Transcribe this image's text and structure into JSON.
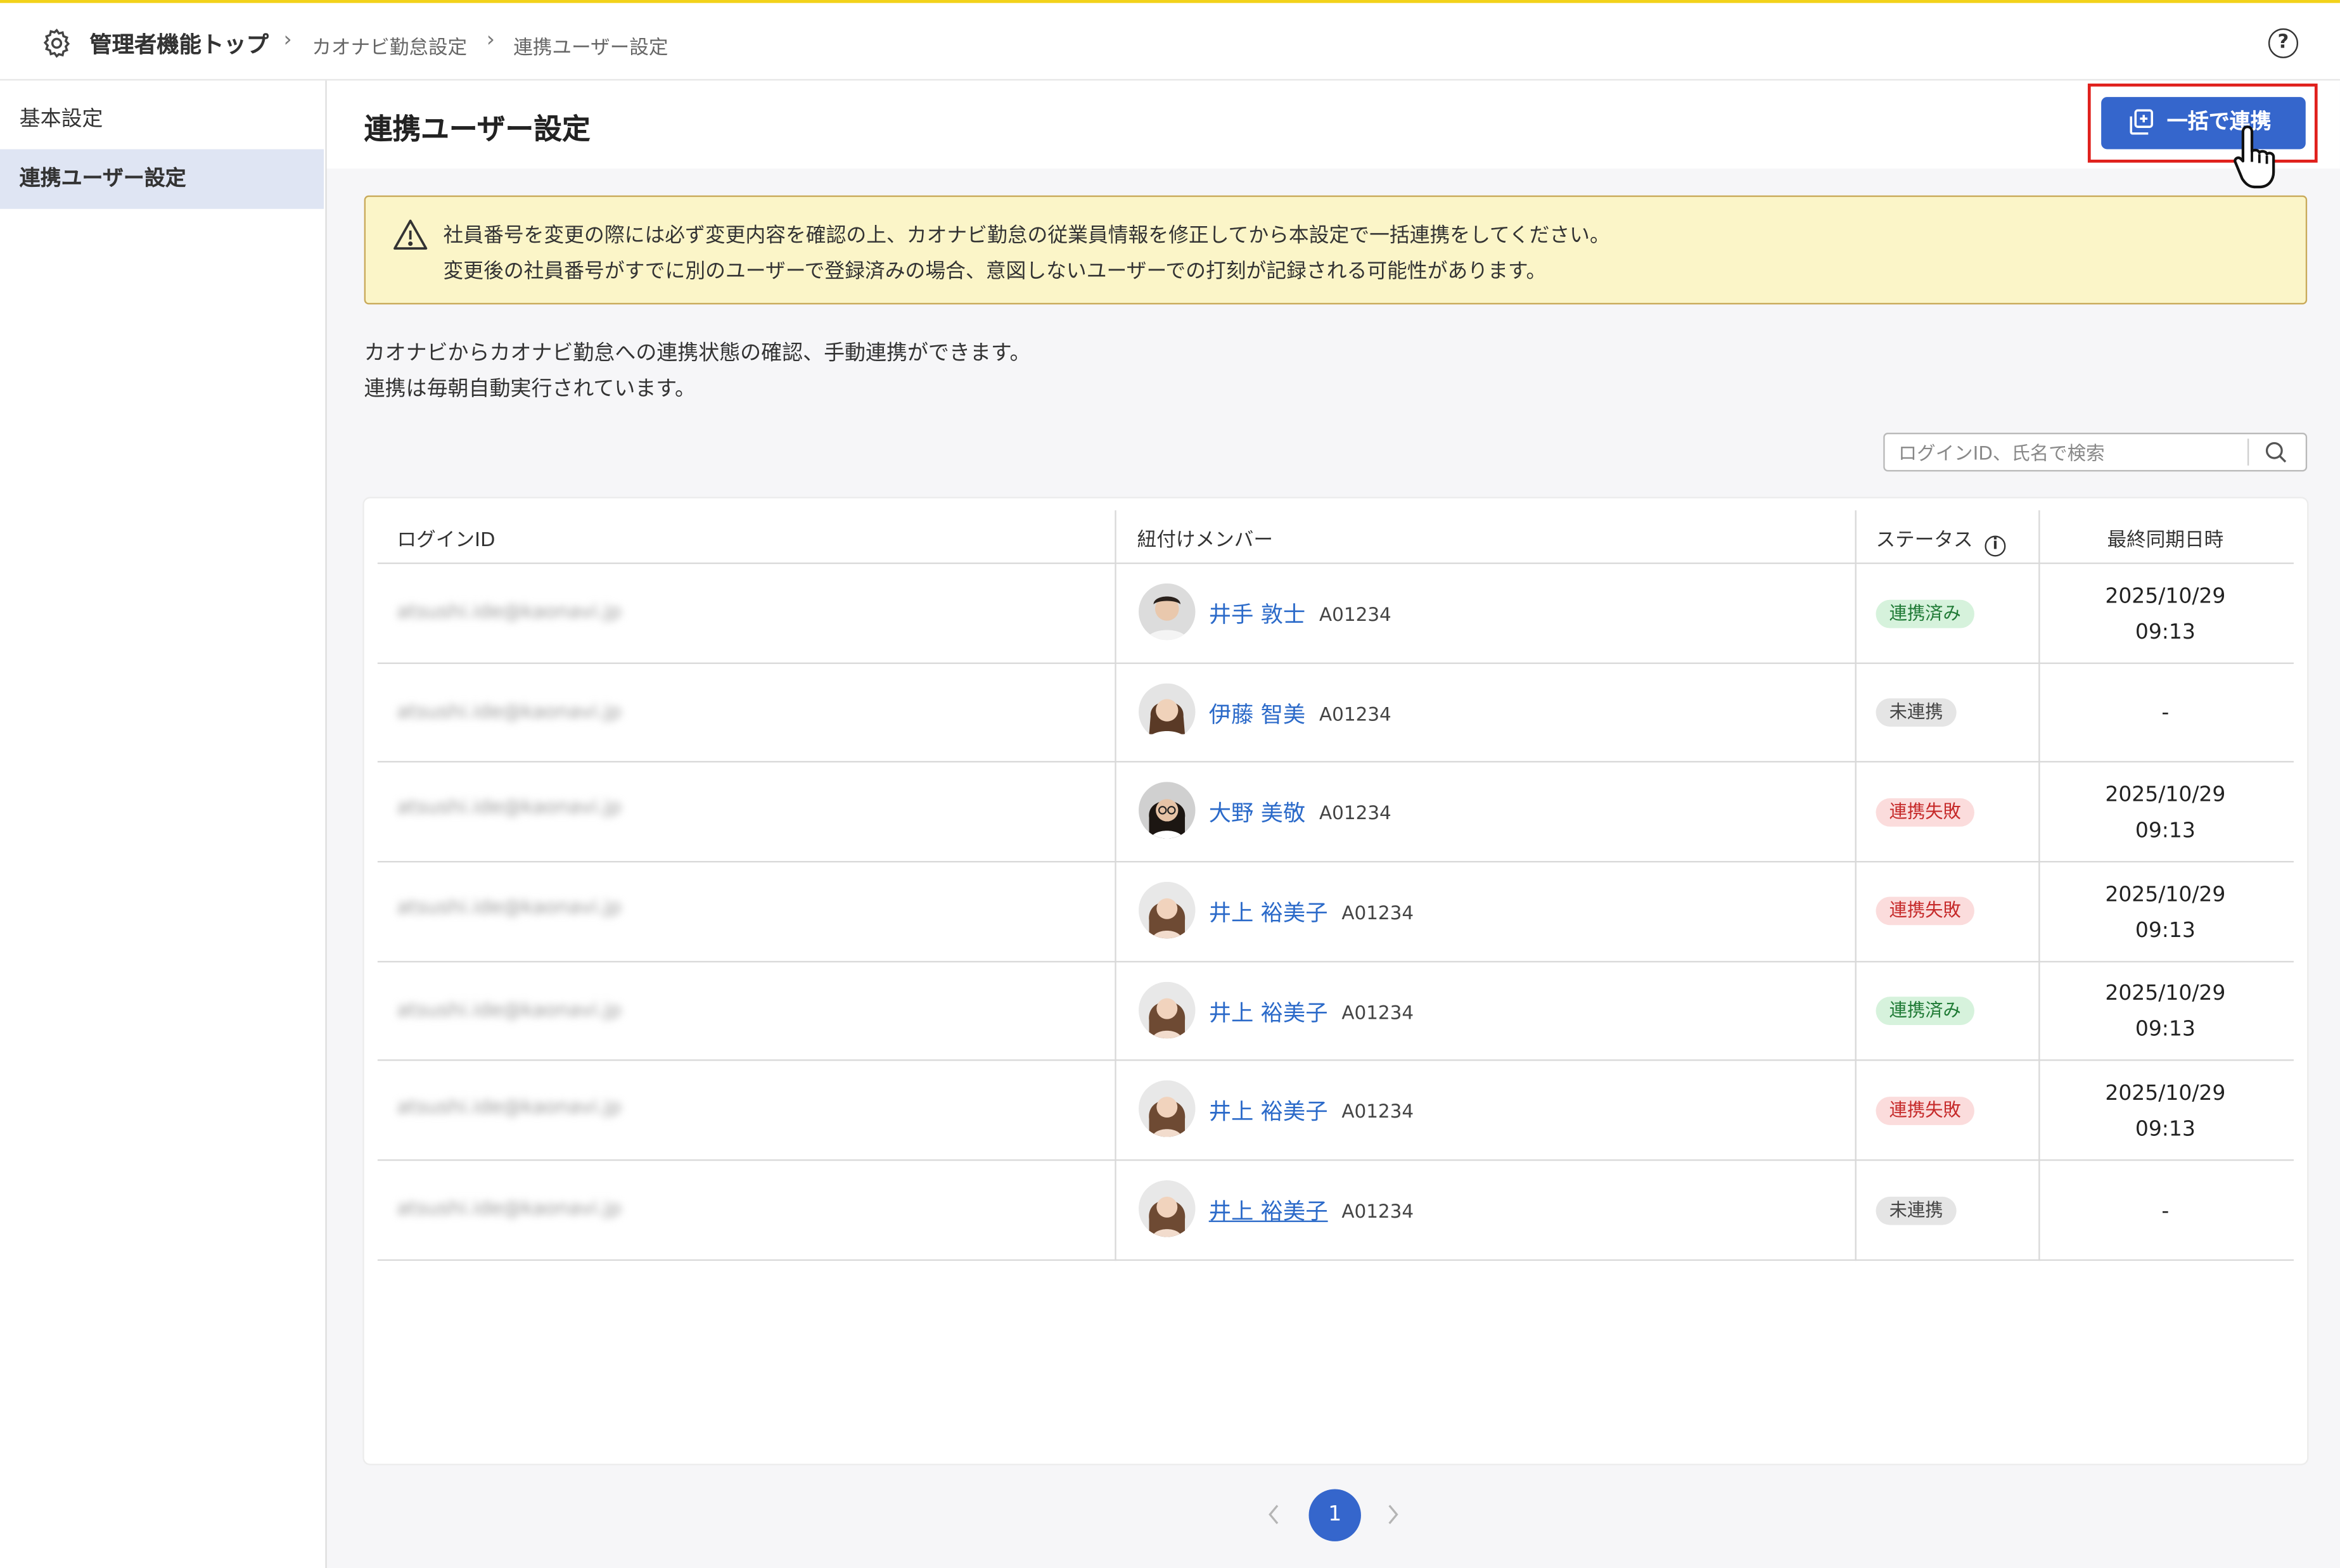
{
  "breadcrumb": {
    "root": "管理者機能トップ",
    "items": [
      "カオナビ勤怠設定",
      "連携ユーザー設定"
    ]
  },
  "sidebar": {
    "items": [
      {
        "label": "基本設定",
        "active": false
      },
      {
        "label": "連携ユーザー設定",
        "active": true
      }
    ]
  },
  "page": {
    "title": "連携ユーザー設定",
    "bulk_button_label": "一括で連携"
  },
  "warning": {
    "lines": [
      "社員番号を変更の際には必ず変更内容を確認の上、カオナビ勤怠の従業員情報を修正してから本設定で一括連携をしてください。",
      "変更後の社員番号がすでに別のユーザーで登録済みの場合、意図しないユーザーでの打刻が記録される可能性があります。"
    ]
  },
  "description": {
    "lines": [
      "カオナビからカオナビ勤怠への連携状態の確認、手動連携ができます。",
      "連携は毎朝自動実行されています。"
    ]
  },
  "search": {
    "placeholder": "ログインID、氏名で検索",
    "value": ""
  },
  "table": {
    "columns": [
      "ログインID",
      "紐付けメンバー",
      "ステータス",
      "最終同期日時"
    ],
    "rows": [
      {
        "login": "atsushi.ide@kaonavi.jp",
        "name": "井手 敦士",
        "code": "A01234",
        "status": "連携済み",
        "sync_date": "2025/10/29",
        "sync_time": "09:13"
      },
      {
        "login": "atsushi.ide@kaonavi.jp",
        "name": "伊藤 智美",
        "code": "A01234",
        "status": "未連携",
        "sync_date": "-",
        "sync_time": ""
      },
      {
        "login": "atsushi.ide@kaonavi.jp",
        "name": "大野 美敬",
        "code": "A01234",
        "status": "連携失敗",
        "sync_date": "2025/10/29",
        "sync_time": "09:13"
      },
      {
        "login": "atsushi.ide@kaonavi.jp",
        "name": "井上 裕美子",
        "code": "A01234",
        "status": "連携失敗",
        "sync_date": "2025/10/29",
        "sync_time": "09:13"
      },
      {
        "login": "atsushi.ide@kaonavi.jp",
        "name": "井上 裕美子",
        "code": "A01234",
        "status": "連携済み",
        "sync_date": "2025/10/29",
        "sync_time": "09:13"
      },
      {
        "login": "atsushi.ide@kaonavi.jp",
        "name": "井上 裕美子",
        "code": "A01234",
        "status": "連携失敗",
        "sync_date": "2025/10/29",
        "sync_time": "09:13"
      },
      {
        "login": "atsushi.ide@kaonavi.jp",
        "name": "井上 裕美子",
        "code": "A01234",
        "status": "未連携",
        "sync_date": "-",
        "sync_time": ""
      }
    ]
  },
  "pagination": {
    "current": "1"
  },
  "colors": {
    "accent": "#3566cc",
    "link": "#2b6ac9",
    "warning_bg": "#fbf5c8",
    "status_ok": "#1f7a35",
    "status_fail": "#c62a2a",
    "highlight_frame": "#e0201c"
  }
}
